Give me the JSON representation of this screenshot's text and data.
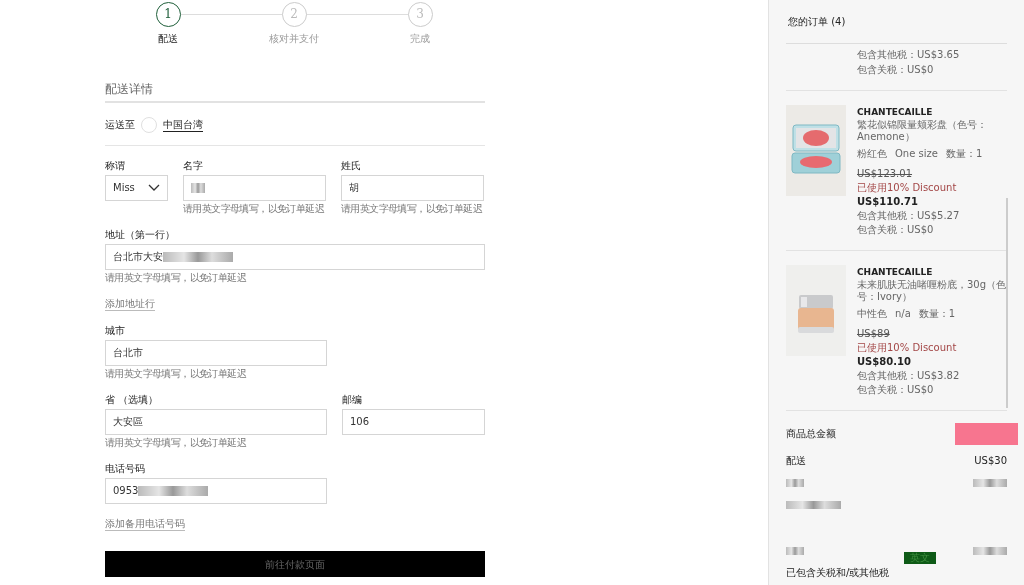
{
  "steps": [
    {
      "number": "1",
      "label": "配送",
      "selected": true
    },
    {
      "number": "2",
      "label": "核对并支付",
      "selected": false
    },
    {
      "number": "3",
      "label": "完成",
      "selected": false
    }
  ],
  "section_title": "配送详情",
  "ship_to": {
    "label": "运送至",
    "country": "中国台湾",
    "selected": false
  },
  "form_rows": [
    {
      "fields": [
        {
          "kind": "select",
          "label": "称谓",
          "value": "Miss"
        },
        {
          "kind": "text",
          "label": "名字",
          "redacted": true,
          "hint": "请用英文字母填写，以免订单延迟"
        },
        {
          "kind": "text",
          "label": "姓氏",
          "value": "胡",
          "hint": "请用英文字母填写，以免订单延迟"
        }
      ]
    },
    {
      "fields": [
        {
          "kind": "text",
          "label": "地址（第一行）",
          "value": "台北市大安",
          "redacted": true,
          "hint": "请用英文字母填写，以免订单延迟"
        }
      ]
    },
    {
      "fields": [
        {
          "kind": "link",
          "label": "添加地址行"
        }
      ]
    },
    {
      "fields": [
        {
          "kind": "text",
          "label": "城市",
          "value": "台北市",
          "hint": "请用英文字母填写，以免订单延迟"
        }
      ]
    },
    {
      "fields": [
        {
          "kind": "text",
          "label": "省 （选填）",
          "value": "大安區",
          "hint": "请用英文字母填写，以免订单延迟"
        },
        {
          "kind": "text",
          "label": "邮编",
          "value": "106"
        }
      ]
    },
    {
      "fields": [
        {
          "kind": "text",
          "label": "电话号码",
          "value": "0953",
          "redacted": true
        }
      ]
    },
    {
      "fields": [
        {
          "kind": "link",
          "label": "添加备用电话号码"
        }
      ]
    }
  ],
  "submit_button": "前往付款页面",
  "order": {
    "title": "您的订单 (4)",
    "partial_item": {
      "other_tax": "包含其他税：US$3.65",
      "duty": "包含关税：US$0"
    },
    "items": [
      {
        "kind": "compact",
        "brand": "CHANTECAILLE",
        "name": "繁花似锦限量颊彩盘（色号：Anemone）",
        "shade": "粉红色",
        "size": "One size",
        "quantity": "数量：1",
        "old_price": "US$123.01",
        "discount": "已使用10% Discount",
        "price": "US$110.71",
        "other_tax": "包含其他税：US$5.27",
        "duty": "包含关税：US$0"
      },
      {
        "kind": "jar",
        "brand": "CHANTECAILLE",
        "name": "未来肌肤无油啫喱粉底，30g（色号：Ivory）",
        "shade": "中性色",
        "size": "n/a",
        "quantity": "数量：1",
        "old_price": "US$89",
        "discount": "已使用10% Discount",
        "price": "US$80.10",
        "other_tax": "包含其他税：US$3.82",
        "duty": "包含关税：US$0"
      }
    ],
    "summary": [
      {
        "label": "商品总金额",
        "value_redacted": true,
        "color": "#f7758f"
      },
      {
        "label": "配送",
        "value": "US$30"
      },
      {
        "label_redacted": true,
        "value_redacted": true
      },
      {
        "label_redacted": true
      },
      {
        "label_redacted": true,
        "value_redacted": true
      },
      {
        "label": "已包含关税和/或其他税"
      }
    ],
    "ime_toolbar": {
      "label": "英文"
    }
  }
}
